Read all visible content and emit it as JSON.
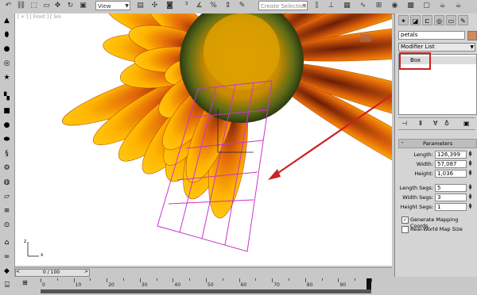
{
  "toolbar": {
    "view_dropdown": "View",
    "selection_set_placeholder": "Create Selection Se",
    "icons": [
      "select-icon",
      "region-icon",
      "move-icon",
      "rotate-icon",
      "scale-icon",
      "reference-dropdown",
      "pivot-icon",
      "snap-icon",
      "angle-snap-icon",
      "percent-snap-icon",
      "spinner-snap-icon",
      "mirror-icon",
      "align-icon",
      "layers-icon",
      "curve-editor-icon",
      "schematic-icon",
      "material-editor-icon",
      "render-setup-icon",
      "render-frame-icon",
      "render-icon"
    ]
  },
  "viewport": {
    "label": "[ + ] [ Front ] [ Sm"
  },
  "panel": {
    "object_name": "petals",
    "object_color": "#d4895a",
    "modifier_list_label": "Modifier List",
    "stack_items": [
      "Box"
    ],
    "parameters_title": "Parameters",
    "params": [
      {
        "label": "Length:",
        "value": "126,399"
      },
      {
        "label": "Width:",
        "value": "57,087"
      },
      {
        "label": "Height:",
        "value": "1,036"
      },
      {
        "label": "Length Segs:",
        "value": "5"
      },
      {
        "label": "Width Segs:",
        "value": "3"
      },
      {
        "label": "Height Segs:",
        "value": "1"
      }
    ],
    "generate_mapping_label": "Generate Mapping Coords.",
    "generate_mapping_checked": true,
    "real_world_label": "Real-World Map Size",
    "real_world_checked": false,
    "minus_label": "-"
  },
  "timeline": {
    "frame_readout": "0 / 100",
    "tick_labels": [
      "0",
      "10",
      "20",
      "30",
      "40",
      "50",
      "60",
      "70",
      "80",
      "90"
    ]
  },
  "axis": {
    "z": "z",
    "x": "x"
  },
  "colors": {
    "highlight_box": "#cc2222",
    "gizmo": "#cc33cc"
  }
}
